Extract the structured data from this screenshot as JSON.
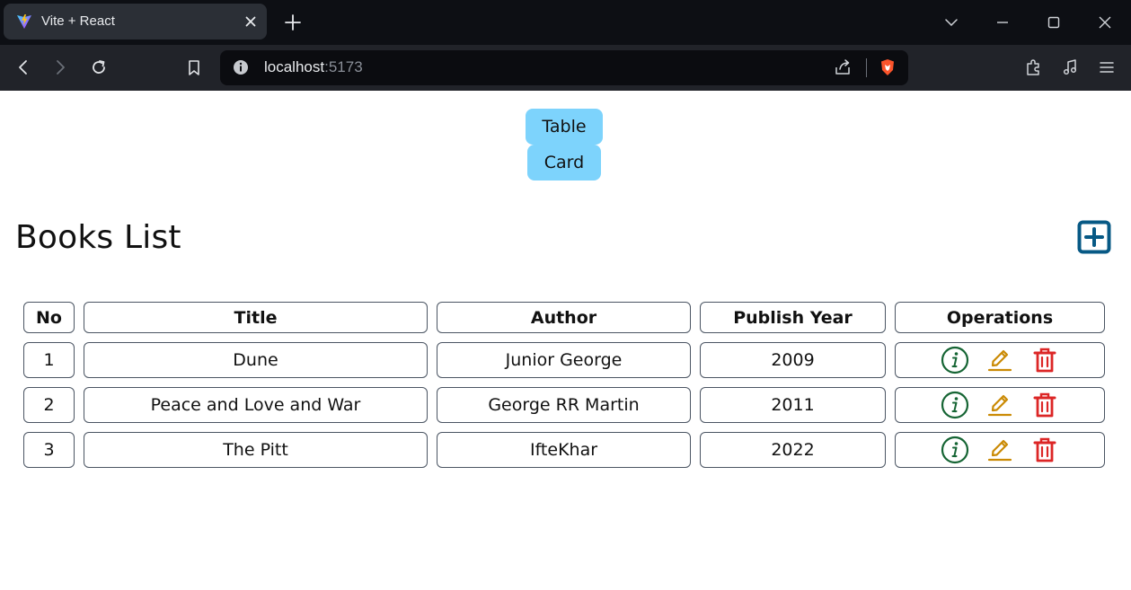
{
  "browser": {
    "tab_title": "Vite + React",
    "url_host": "localhost",
    "url_port": ":5173"
  },
  "view_toggle": {
    "table_label": "Table",
    "card_label": "Card"
  },
  "page": {
    "title": "Books List"
  },
  "table": {
    "headers": [
      "No",
      "Title",
      "Author",
      "Publish Year",
      "Operations"
    ],
    "rows": [
      {
        "no": "1",
        "title": "Dune",
        "author": "Junior George",
        "year": "2009"
      },
      {
        "no": "2",
        "title": "Peace and Love and War",
        "author": "George RR Martin",
        "year": "2011"
      },
      {
        "no": "3",
        "title": "The Pitt",
        "author": "IfteKhar",
        "year": "2022"
      }
    ]
  },
  "colors": {
    "view_button": "#7dd3fc",
    "add_icon": "#075985",
    "info_icon": "#166534",
    "edit_icon": "#ca8a04",
    "delete_icon": "#dc2626"
  }
}
